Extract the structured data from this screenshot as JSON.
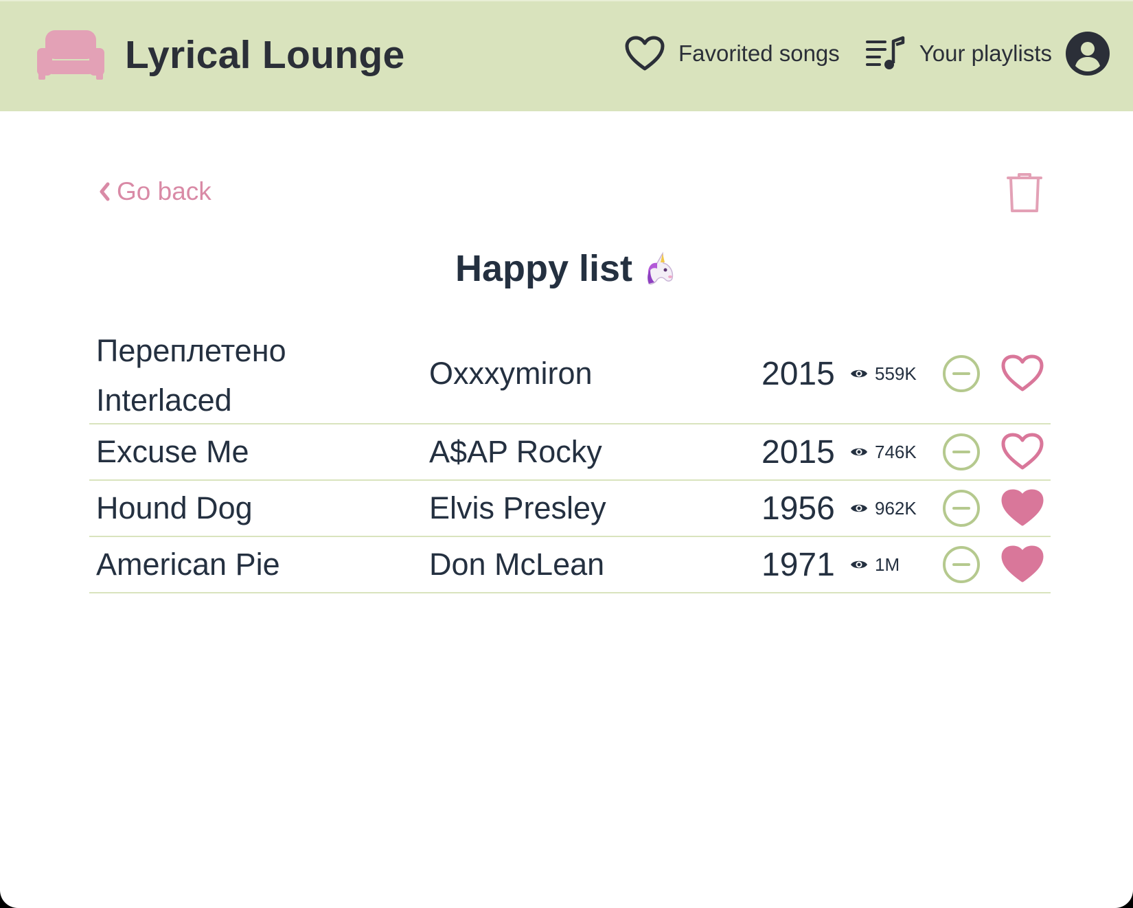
{
  "app": {
    "title": "Lyrical Lounge",
    "logo_icon": "sofa-icon"
  },
  "nav": {
    "favorites_label": "Favorited songs",
    "favorites_icon": "heart-outline-icon",
    "playlists_label": "Your playlists",
    "playlists_icon": "playlist-music-icon",
    "account_icon": "user-avatar-icon"
  },
  "page": {
    "back_label": "Go back",
    "delete_icon": "trash-icon",
    "playlist_title": "Happy list",
    "playlist_emoji": "unicorn-emoji"
  },
  "songs": [
    {
      "title_line1": "Переплетено",
      "title_line2": "Interlaced",
      "artist": "Oxxxymiron",
      "year": "2015",
      "views": "559K",
      "favorited": false
    },
    {
      "title": "Excuse Me",
      "artist": "A$AP Rocky",
      "year": "2015",
      "views": "746K",
      "favorited": false
    },
    {
      "title": "Hound Dog",
      "artist": "Elvis Presley",
      "year": "1956",
      "views": "962K",
      "favorited": true
    },
    {
      "title": "American Pie",
      "artist": "Don McLean",
      "year": "1971",
      "views": "1M",
      "favorited": true
    }
  ],
  "colors": {
    "navbar_bg": "#d9e3bd",
    "accent_pink": "#d98aa6",
    "accent_green": "#b5c98e",
    "text_dark": "#243040"
  }
}
